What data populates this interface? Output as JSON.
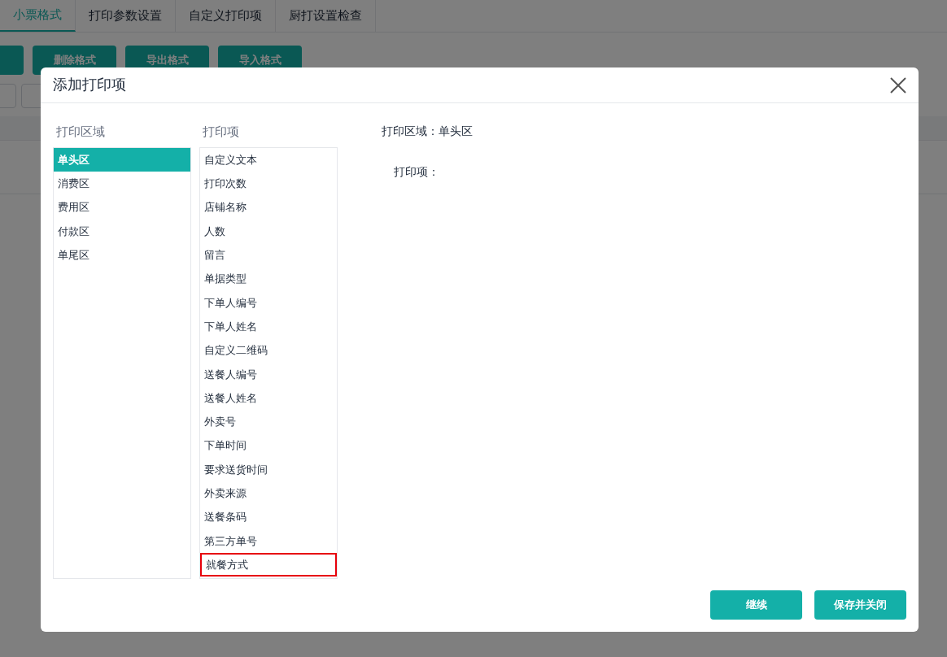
{
  "tabs": [
    {
      "label": "小票格式",
      "selected": true
    },
    {
      "label": "打印参数设置",
      "selected": false
    },
    {
      "label": "自定义打印项",
      "selected": false
    },
    {
      "label": "厨打设置检查",
      "selected": false
    }
  ],
  "toolbar_buttons": [
    "删除格式",
    "导出格式",
    "导入格式"
  ],
  "dialog": {
    "title": "添加打印项",
    "areas_heading": "打印区域",
    "areas": [
      {
        "label": "单头区",
        "selected": true
      },
      {
        "label": "消费区",
        "selected": false
      },
      {
        "label": "费用区",
        "selected": false
      },
      {
        "label": "付款区",
        "selected": false
      },
      {
        "label": "单尾区",
        "selected": false
      }
    ],
    "items_heading": "打印项",
    "items": [
      {
        "label": "自定义文本",
        "highlighted": false
      },
      {
        "label": "打印次数",
        "highlighted": false
      },
      {
        "label": "店铺名称",
        "highlighted": false
      },
      {
        "label": "人数",
        "highlighted": false
      },
      {
        "label": "留言",
        "highlighted": false
      },
      {
        "label": "单据类型",
        "highlighted": false
      },
      {
        "label": "下单人编号",
        "highlighted": false
      },
      {
        "label": "下单人姓名",
        "highlighted": false
      },
      {
        "label": "自定义二维码",
        "highlighted": false
      },
      {
        "label": "送餐人编号",
        "highlighted": false
      },
      {
        "label": "送餐人姓名",
        "highlighted": false
      },
      {
        "label": "外卖号",
        "highlighted": false
      },
      {
        "label": "下单时间",
        "highlighted": false
      },
      {
        "label": "要求送货时间",
        "highlighted": false
      },
      {
        "label": "外卖来源",
        "highlighted": false
      },
      {
        "label": "送餐条码",
        "highlighted": false
      },
      {
        "label": "第三方单号",
        "highlighted": false
      },
      {
        "label": "就餐方式",
        "highlighted": true
      }
    ],
    "area_label": "打印区域：",
    "area_value": "单头区",
    "item_label": "打印项：",
    "buttons": [
      "继续",
      "保存并关闭"
    ]
  }
}
